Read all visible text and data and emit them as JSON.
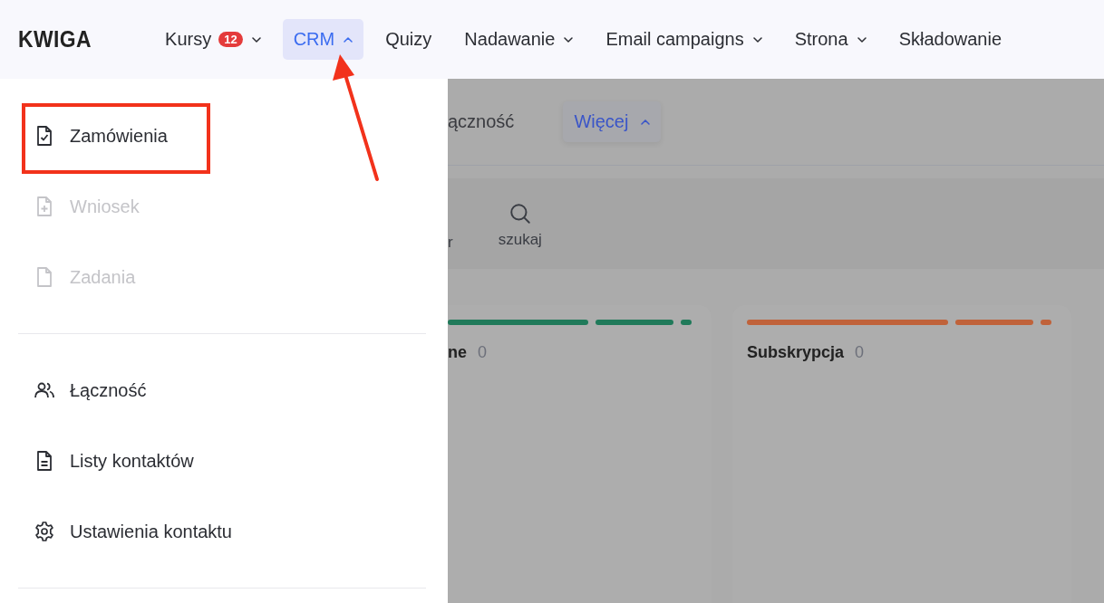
{
  "nav": {
    "logo": "KWIGA",
    "items": [
      {
        "label": "Kursy",
        "badge": "12",
        "kind": "dropdown",
        "expanded": false,
        "selected": false
      },
      {
        "label": "CRM",
        "kind": "dropdown",
        "expanded": true,
        "selected": true
      },
      {
        "label": "Quizy",
        "kind": "link",
        "selected": false
      },
      {
        "label": "Nadawanie",
        "kind": "dropdown",
        "expanded": false,
        "selected": false
      },
      {
        "label": "Email campaigns",
        "kind": "dropdown",
        "expanded": false,
        "selected": false
      },
      {
        "label": "Strona",
        "kind": "dropdown",
        "expanded": false,
        "selected": false
      },
      {
        "label": "Składowanie",
        "kind": "link",
        "selected": false
      }
    ]
  },
  "dropdown": {
    "groups": [
      [
        {
          "label": "Zamówienia",
          "kind": "doc-check",
          "disabled": false,
          "highlighted": true
        },
        {
          "label": "Wniosek",
          "kind": "doc-plus",
          "disabled": true,
          "highlighted": false
        },
        {
          "label": "Zadania",
          "kind": "doc",
          "disabled": true,
          "highlighted": false
        }
      ],
      [
        {
          "label": "Łączność",
          "kind": "users",
          "disabled": false,
          "highlighted": false
        },
        {
          "label": "Listy kontaktów",
          "kind": "doc-lines",
          "disabled": false,
          "highlighted": false
        },
        {
          "label": "Ustawienia kontaktu",
          "kind": "gear",
          "disabled": false,
          "highlighted": false
        }
      ]
    ]
  },
  "page": {
    "tabs": [
      {
        "label": "ączność",
        "selected": false
      },
      {
        "label": "Więcej",
        "selected": true,
        "expanded": true
      }
    ],
    "toolbar": [
      {
        "label": "r",
        "kind": "plain"
      },
      {
        "label": "szukaj",
        "kind": "search"
      }
    ],
    "columns": [
      {
        "title": "ne",
        "count": "0",
        "color": "#207a5a"
      },
      {
        "title": "Subskrypcja",
        "count": "0",
        "color": "#c0623a"
      }
    ]
  }
}
